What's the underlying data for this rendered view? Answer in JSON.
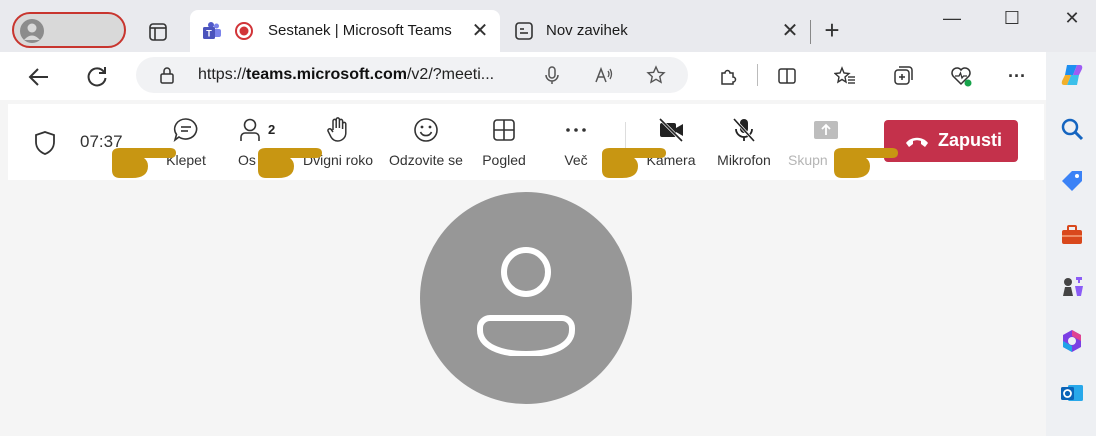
{
  "browser": {
    "tabs": [
      {
        "title": "Sestanek | Microsoft Teams",
        "close": "✕"
      },
      {
        "title": "Nov zavihek",
        "close": "✕"
      }
    ],
    "new_tab": "+",
    "window_controls": {
      "minimize": "—",
      "maximize": "☐",
      "close": "✕"
    },
    "address": {
      "prefix": "https://",
      "host": "teams.microsoft.com",
      "path": "/v2/?meeti..."
    },
    "toolbar": {
      "more": "···"
    },
    "colors": {
      "profile_outline": "#c8352e",
      "leave_button": "#c4314b",
      "pointer_hands": "#c89612"
    }
  },
  "meeting": {
    "timer": "07:37",
    "controls": {
      "chat": "Klepet",
      "people": "Osebe",
      "people_count": "2",
      "raise_hand": "Dvigni roko",
      "react": "Odzovite se",
      "view": "Pogled",
      "more": "Več",
      "camera": "Kamera",
      "mic": "Mikrofon",
      "share": "Skupna raba"
    },
    "visible_labels": {
      "people_partial": "Os",
      "share_partial": "Skupn"
    },
    "leave": "Zapusti"
  }
}
